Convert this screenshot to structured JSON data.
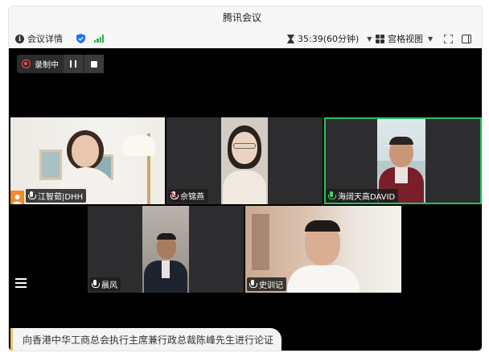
{
  "window": {
    "title": "腾讯会议"
  },
  "toolbar": {
    "meeting_info_label": "会议详情",
    "timer_text": "35:39(60分钟)",
    "view_label": "宫格视图"
  },
  "recording": {
    "label": "录制中"
  },
  "participants": [
    {
      "name": "江智茹|DHH",
      "mic": "on",
      "host": true
    },
    {
      "name": "佘锦燕",
      "mic": "muted"
    },
    {
      "name": "海阔天高DAVID",
      "mic": "speaking",
      "active": true
    },
    {
      "name": "晨风",
      "mic": "on"
    },
    {
      "name": "史训记",
      "mic": "on"
    }
  ],
  "subtitle": {
    "text": "向香港中华工商总会执行主席兼行政总裁陈峰先生进行论证"
  },
  "colors": {
    "speaking_border": "#26c25d",
    "recording": "#ff4a4a",
    "host_badge": "#f28c28"
  }
}
